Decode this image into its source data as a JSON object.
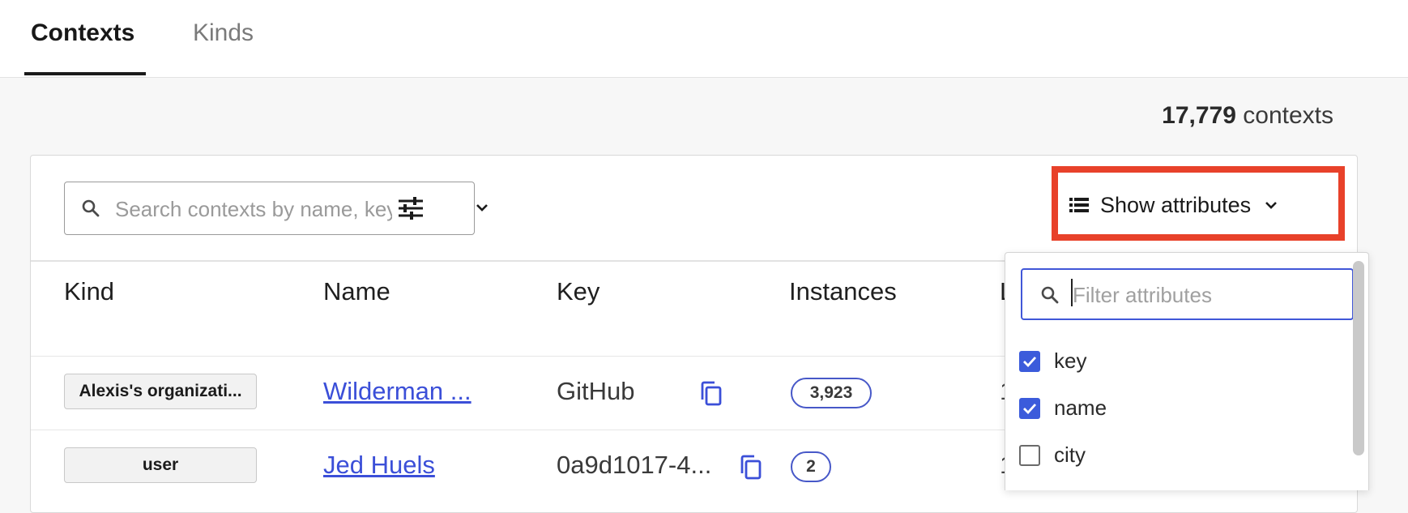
{
  "tabs": [
    {
      "label": "Contexts",
      "active": true
    },
    {
      "label": "Kinds",
      "active": false
    }
  ],
  "summary": {
    "count": "17,779",
    "unit": "contexts"
  },
  "search": {
    "placeholder": "Search contexts by name, key, or attribute",
    "value": ""
  },
  "show_attributes": {
    "label": "Show attributes"
  },
  "columns": [
    "Kind",
    "Name",
    "Key",
    "Instances",
    "L"
  ],
  "rows": [
    {
      "kind": "Alexis's organizati...",
      "name": "Wilderman ...",
      "key": "GitHub",
      "instances": "3,923",
      "last_seen": "1"
    },
    {
      "kind": "user",
      "name": "Jed Huels",
      "key": "0a9d1017-4...",
      "instances": "2",
      "last_seen": "1"
    }
  ],
  "attribute_filter": {
    "placeholder": "Filter attributes",
    "value": "",
    "items": [
      {
        "label": "key",
        "checked": true
      },
      {
        "label": "name",
        "checked": true
      },
      {
        "label": "city",
        "checked": false
      }
    ]
  },
  "colors": {
    "accent": "#3b5bdb",
    "link": "#3b4fd8",
    "highlight": "#e8412a"
  },
  "icons": [
    "search-icon",
    "tune-icon",
    "chevron-down-icon",
    "list-icon",
    "copy-icon",
    "check-icon"
  ]
}
